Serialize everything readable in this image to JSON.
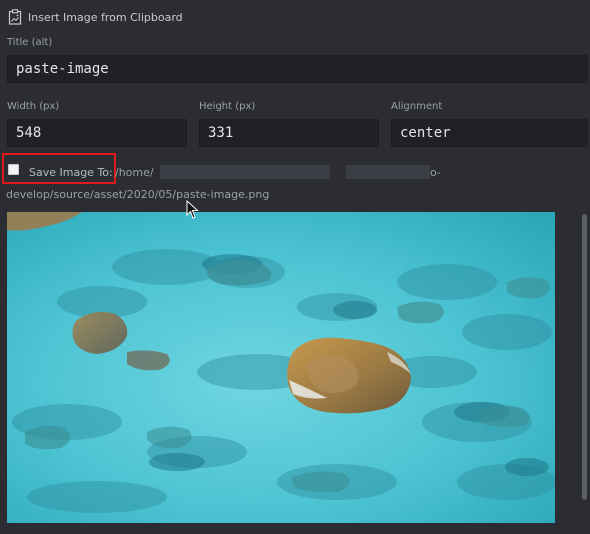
{
  "header": {
    "title": "Insert Image from Clipboard"
  },
  "form": {
    "title_label": "Title (alt)",
    "title_value": "paste-image",
    "width_label": "Width (px)",
    "width_value": "548",
    "height_label": "Height (px)",
    "height_value": "331",
    "alignment_label": "Alignment",
    "alignment_value": "center"
  },
  "save": {
    "label": "Save Image To:",
    "checked": false,
    "path_start": "/home/",
    "path_tail": "o-",
    "path_line2": "develop/source/asset/2020/05/paste-image.png"
  },
  "icons": {
    "header_icon": "clipboard-image-icon",
    "cursor": "mouse-pointer-icon"
  },
  "colors": {
    "background": "#2b2d33",
    "field_bg": "#1f2126",
    "highlight_box": "#e01a1a"
  }
}
